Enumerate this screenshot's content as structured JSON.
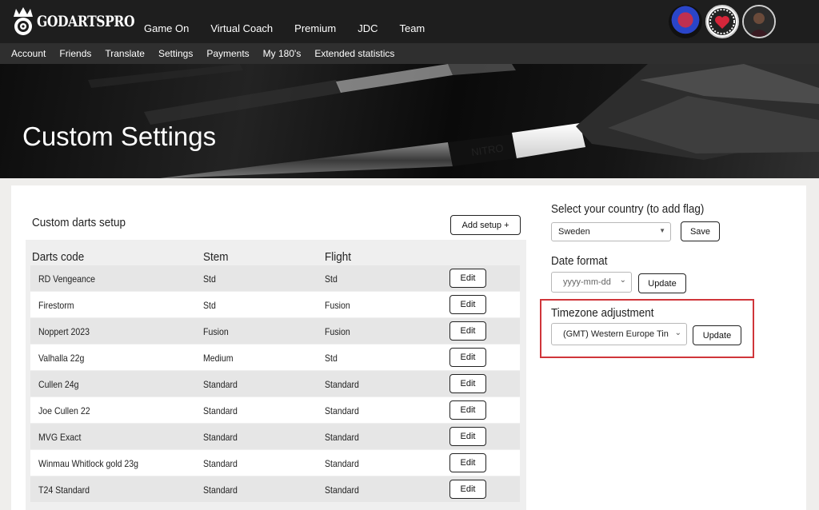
{
  "brand": {
    "name": "GODARTSPRO"
  },
  "main_nav": [
    "Game On",
    "Virtual Coach",
    "Premium",
    "JDC",
    "Team"
  ],
  "sub_nav": [
    "Account",
    "Friends",
    "Translate",
    "Settings",
    "Payments",
    "My 180's",
    "Extended statistics"
  ],
  "hero": {
    "title": "Custom Settings"
  },
  "darts_setup": {
    "title": "Custom darts setup",
    "add_button": "Add setup +",
    "columns": [
      "Darts code",
      "Stem",
      "Flight"
    ],
    "edit_label": "Edit",
    "rows": [
      {
        "code": "RD Vengeance",
        "stem": "Std",
        "flight": "Std"
      },
      {
        "code": "Firestorm",
        "stem": "Std",
        "flight": "Fusion"
      },
      {
        "code": "Noppert 2023",
        "stem": "Fusion",
        "flight": "Fusion"
      },
      {
        "code": "Valhalla 22g",
        "stem": "Medium",
        "flight": "Std"
      },
      {
        "code": "Cullen 24g",
        "stem": "Standard",
        "flight": "Standard"
      },
      {
        "code": "Joe Cullen 22",
        "stem": "Standard",
        "flight": "Standard"
      },
      {
        "code": "MVG Exact",
        "stem": "Standard",
        "flight": "Standard"
      },
      {
        "code": "Winmau Whitlock gold 23g",
        "stem": "Standard",
        "flight": "Standard"
      },
      {
        "code": "T24 Standard",
        "stem": "Standard",
        "flight": "Standard"
      }
    ]
  },
  "country": {
    "title": "Select your country (to add flag)",
    "value": "Sweden",
    "button": "Save"
  },
  "date_format": {
    "title": "Date format",
    "value": "yyyy-mm-dd",
    "button": "Update"
  },
  "timezone": {
    "title": "Timezone adjustment",
    "value": "(GMT) Western Europe Tin",
    "button": "Update",
    "highlight_color": "#d0353a"
  }
}
